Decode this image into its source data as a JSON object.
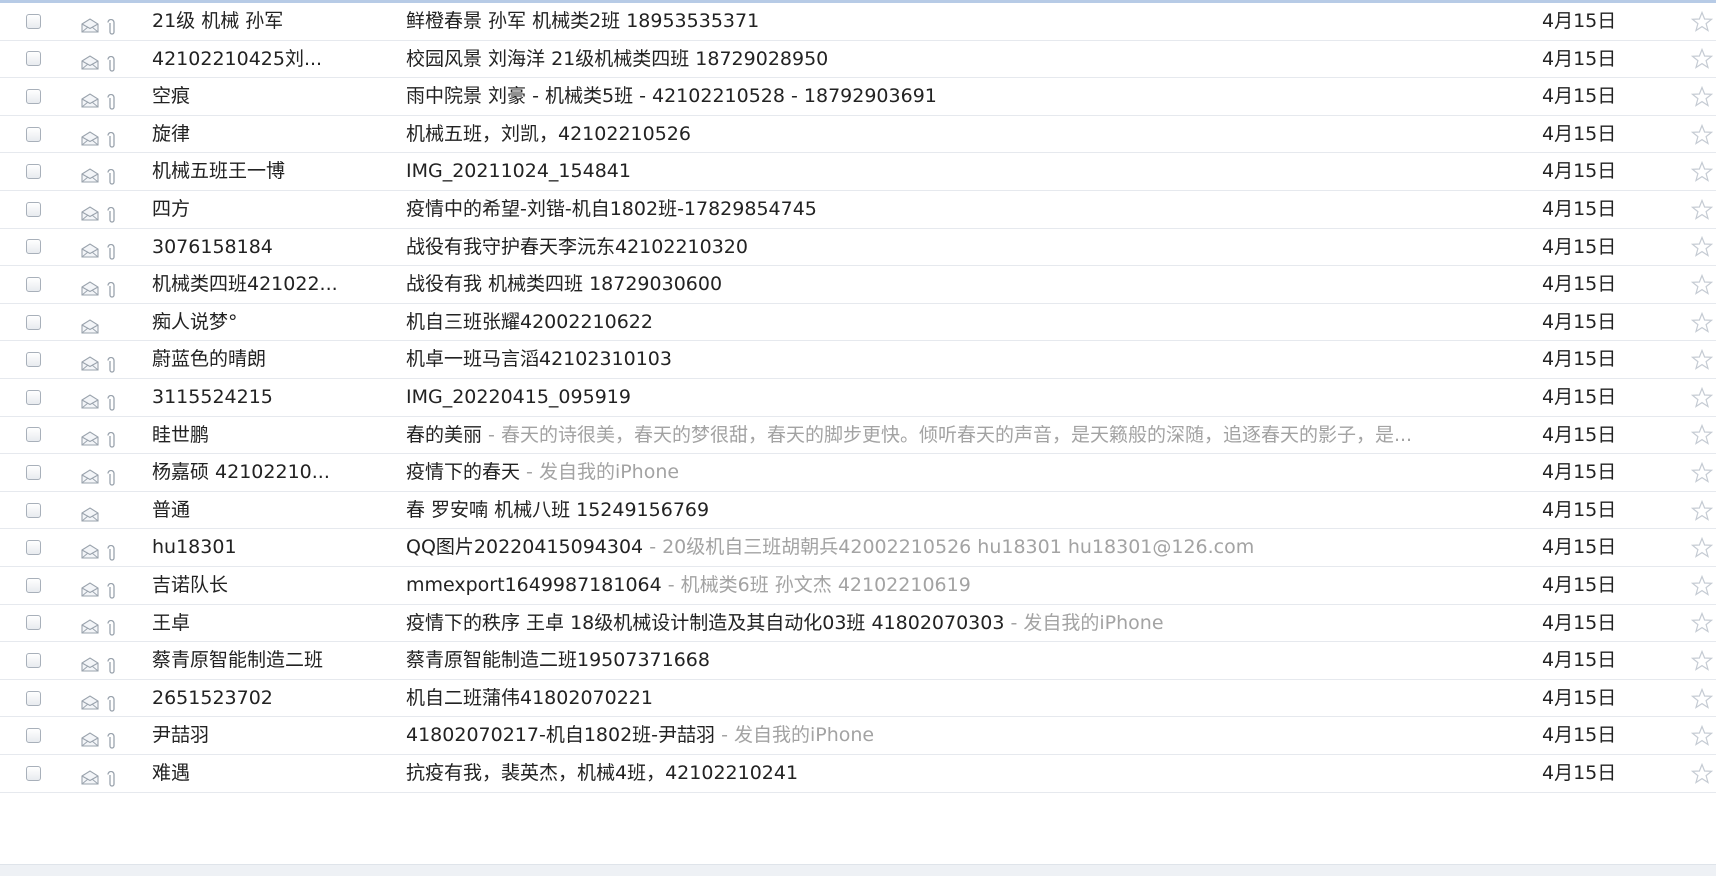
{
  "icons": {
    "checkbox": "checkbox",
    "envelope": "envelope-open-icon",
    "attachment": "paperclip-icon",
    "star": "star-outline-icon"
  },
  "colors": {
    "preview_text": "#a3a3a3",
    "row_divider": "#e6e9ee",
    "top_border": "#b7cbe6"
  },
  "emails": [
    {
      "from": "21级 机械  孙军",
      "subject": "鲜橙春景    孙军   机械类2班   18953535371",
      "preview": "",
      "date": "4月15日",
      "has_attachment": true
    },
    {
      "from": "42102210425刘...",
      "subject": "校园风景  刘海洋  21级机械类四班  18729028950",
      "preview": "",
      "date": "4月15日",
      "has_attachment": true
    },
    {
      "from": "空痕",
      "subject": "雨中院景  刘豪 - 机械类5班 - 42102210528 - 18792903691",
      "preview": "",
      "date": "4月15日",
      "has_attachment": true
    },
    {
      "from": "旋律",
      "subject": "机械五班，刘凯，42102210526",
      "preview": "",
      "date": "4月15日",
      "has_attachment": true
    },
    {
      "from": "机械五班王一博",
      "subject": "IMG_20211024_154841",
      "preview": "",
      "date": "4月15日",
      "has_attachment": true
    },
    {
      "from": "四方",
      "subject": "疫情中的希望-刘锴-机自1802班-17829854745",
      "preview": "",
      "date": "4月15日",
      "has_attachment": true
    },
    {
      "from": "3076158184",
      "subject": "战役有我守护春天李沅东42102210320",
      "preview": "",
      "date": "4月15日",
      "has_attachment": true
    },
    {
      "from": "机械类四班421022...",
      "subject": "战役有我 机械类四班 18729030600",
      "preview": "",
      "date": "4月15日",
      "has_attachment": true
    },
    {
      "from": "痴人说梦°",
      "subject": "机自三班张耀42002210622",
      "preview": "",
      "date": "4月15日",
      "has_attachment": false
    },
    {
      "from": "蔚蓝色的晴朗",
      "subject": "机卓一班马言滔42102310103",
      "preview": "",
      "date": "4月15日",
      "has_attachment": true
    },
    {
      "from": "3115524215",
      "subject": "IMG_20220415_095919",
      "preview": "",
      "date": "4月15日",
      "has_attachment": true
    },
    {
      "from": "眭世鹏",
      "subject": "春的美丽",
      "preview": " - 春天的诗很美，春天的梦很甜，春天的脚步更快。倾听春天的声音，是天籁般的深随，追逐春天的影子，是...",
      "date": "4月15日",
      "has_attachment": true
    },
    {
      "from": "杨嘉硕 42102210...",
      "subject": "疫情下的春天",
      "preview": " - 发自我的iPhone",
      "date": "4月15日",
      "has_attachment": true
    },
    {
      "from": "普通",
      "subject": "春 罗安喃 机械八班 15249156769",
      "preview": "",
      "date": "4月15日",
      "has_attachment": false
    },
    {
      "from": "hu18301",
      "subject": "QQ图片20220415094304",
      "preview": " - 20级机自三班胡朝兵42002210526            hu18301  hu18301@126.com",
      "date": "4月15日",
      "has_attachment": true
    },
    {
      "from": "吉诺队长",
      "subject": "mmexport1649987181064",
      "preview": " - 机械类6班 孙文杰 42102210619",
      "date": "4月15日",
      "has_attachment": true
    },
    {
      "from": "王卓",
      "subject": "疫情下的秩序 王卓 18级机械设计制造及其自动化03班 41802070303",
      "preview": " - 发自我的iPhone",
      "date": "4月15日",
      "has_attachment": true
    },
    {
      "from": "蔡青原智能制造二班",
      "subject": "蔡青原智能制造二班19507371668",
      "preview": "",
      "date": "4月15日",
      "has_attachment": true
    },
    {
      "from": "2651523702",
      "subject": "机自二班蒲伟41802070221",
      "preview": "",
      "date": "4月15日",
      "has_attachment": true
    },
    {
      "from": "尹喆羽",
      "subject": "41802070217-机自1802班-尹喆羽",
      "preview": " - 发自我的iPhone",
      "date": "4月15日",
      "has_attachment": true
    },
    {
      "from": "难遇",
      "subject": "抗疫有我，裴英杰，机械4班，42102210241",
      "preview": "",
      "date": "4月15日",
      "has_attachment": true
    }
  ]
}
